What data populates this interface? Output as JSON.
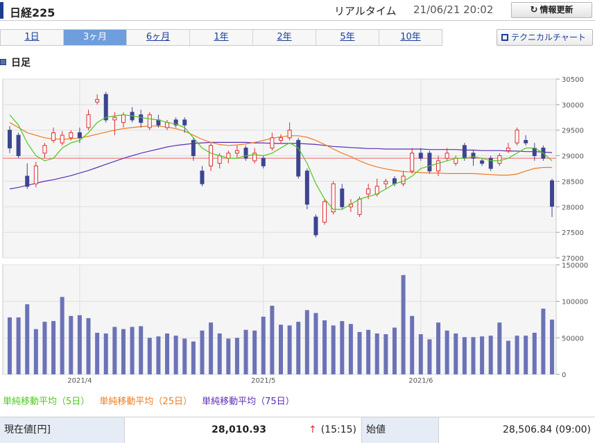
{
  "header": {
    "title": "日経225",
    "realtime_label": "リアルタイム",
    "timestamp": "21/06/21 20:02",
    "refresh_label": "情報更新",
    "refresh_icon": "refresh-icon"
  },
  "tabs": [
    {
      "label": "1日",
      "active": false
    },
    {
      "label": "3ヶ月",
      "active": true
    },
    {
      "label": "6ヶ月",
      "active": false
    },
    {
      "label": "1年",
      "active": false
    },
    {
      "label": "2年",
      "active": false
    },
    {
      "label": "5年",
      "active": false
    },
    {
      "label": "10年",
      "active": false
    }
  ],
  "technical_chart_label": "テクニカルチャート",
  "section_title": "日足",
  "legend": [
    {
      "label": "単純移動平均（5日）",
      "color": "#4cc81e"
    },
    {
      "label": "単純移動平均（25日）",
      "color": "#ef7a1e"
    },
    {
      "label": "単純移動平均（75日）",
      "color": "#5a2db4"
    }
  ],
  "quote": {
    "current_label": "現在値[円]",
    "current_value": "28,010.93",
    "time": "(15:15)",
    "open_label": "始値",
    "open_value": "28,506.84 (09:00)"
  },
  "chart_data": {
    "type": "candlestick",
    "price_axis": {
      "min": 27000,
      "max": 30500,
      "ticks": [
        30500,
        30000,
        29500,
        29000,
        28500,
        28000,
        27500,
        27000
      ]
    },
    "volume_axis": {
      "min": 0,
      "max": 150000,
      "ticks": [
        150000,
        100000,
        50000,
        0
      ]
    },
    "x_labels": [
      {
        "label": "2021/4",
        "index": 8
      },
      {
        "label": "2021/5",
        "index": 29
      },
      {
        "label": "2021/6",
        "index": 47
      }
    ],
    "reference_line": {
      "value": 28950,
      "color": "#f08080"
    },
    "colors": {
      "up": "#e0282e",
      "down": "#3d4591",
      "volume": "#6b72b6"
    },
    "candles": [
      [
        29500,
        29150,
        29580,
        29050
      ],
      [
        29400,
        29000,
        29450,
        28950
      ],
      [
        28600,
        28400,
        28850,
        28350
      ],
      [
        28450,
        28800,
        28880,
        28380
      ],
      [
        29050,
        29200,
        29250,
        28950
      ],
      [
        29300,
        29450,
        29550,
        29250
      ],
      [
        29250,
        29400,
        29480,
        29200
      ],
      [
        29350,
        29450,
        29500,
        29300
      ],
      [
        29450,
        29350,
        29550,
        29250
      ],
      [
        29550,
        29800,
        29900,
        29500
      ],
      [
        30050,
        30100,
        30200,
        30000
      ],
      [
        30200,
        29700,
        30250,
        29650
      ],
      [
        29700,
        29750,
        29850,
        29400
      ],
      [
        29650,
        29800,
        29850,
        29550
      ],
      [
        29850,
        29700,
        29950,
        29650
      ],
      [
        29800,
        29650,
        29900,
        29550
      ],
      [
        29550,
        29800,
        29850,
        29500
      ],
      [
        29700,
        29600,
        29800,
        29550
      ],
      [
        29550,
        29650,
        29700,
        29500
      ],
      [
        29700,
        29600,
        29750,
        29550
      ],
      [
        29700,
        29600,
        29750,
        29450
      ],
      [
        29300,
        29000,
        29350,
        28900
      ],
      [
        28700,
        28450,
        28800,
        28400
      ],
      [
        28800,
        29200,
        29250,
        28700
      ],
      [
        28850,
        29000,
        29050,
        28750
      ],
      [
        28950,
        29050,
        29100,
        28850
      ],
      [
        29050,
        29100,
        29200,
        28950
      ],
      [
        29150,
        28950,
        29200,
        28900
      ],
      [
        28900,
        29050,
        29150,
        28850
      ],
      [
        28950,
        28800,
        29000,
        28750
      ],
      [
        29150,
        29350,
        29450,
        29100
      ],
      [
        29300,
        29350,
        29420,
        29250
      ],
      [
        29350,
        29500,
        29650,
        29300
      ],
      [
        29300,
        28600,
        29350,
        28550
      ],
      [
        28700,
        28050,
        28750,
        27950
      ],
      [
        27800,
        27450,
        27850,
        27400
      ],
      [
        27700,
        28100,
        28150,
        27650
      ],
      [
        27900,
        28450,
        28500,
        27850
      ],
      [
        28350,
        28000,
        28450,
        27950
      ],
      [
        28000,
        28050,
        28150,
        27900
      ],
      [
        27850,
        28150,
        28200,
        27800
      ],
      [
        28250,
        28350,
        28450,
        28150
      ],
      [
        28250,
        28400,
        28550,
        28200
      ],
      [
        28450,
        28500,
        28550,
        28350
      ],
      [
        28550,
        28450,
        28600,
        28400
      ],
      [
        28450,
        28600,
        28700,
        28400
      ],
      [
        28700,
        29050,
        29150,
        28650
      ],
      [
        29050,
        28950,
        29150,
        28900
      ],
      [
        29050,
        28700,
        29100,
        28650
      ],
      [
        28700,
        28900,
        29000,
        28600
      ],
      [
        28950,
        29050,
        29150,
        28900
      ],
      [
        28850,
        28950,
        29000,
        28800
      ],
      [
        29200,
        28950,
        29250,
        28900
      ],
      [
        29050,
        28950,
        29100,
        28800
      ],
      [
        28900,
        28850,
        28950,
        28800
      ],
      [
        28950,
        28750,
        29000,
        28700
      ],
      [
        28850,
        29000,
        29050,
        28800
      ],
      [
        29100,
        29150,
        29250,
        29050
      ],
      [
        29250,
        29500,
        29550,
        29200
      ],
      [
        29300,
        29250,
        29400,
        29200
      ],
      [
        29150,
        29000,
        29250,
        28900
      ],
      [
        29150,
        28950,
        29200,
        28900
      ],
      [
        28510,
        28010,
        28550,
        27800
      ]
    ],
    "volumes": [
      78000,
      78000,
      96000,
      62000,
      72000,
      73000,
      106000,
      80000,
      81000,
      77000,
      57000,
      56000,
      65000,
      62000,
      65000,
      66000,
      50000,
      52000,
      56000,
      53000,
      49000,
      45000,
      60000,
      71000,
      56000,
      49000,
      50000,
      61000,
      60000,
      79000,
      94000,
      68000,
      67000,
      72000,
      88000,
      84000,
      74000,
      67000,
      73000,
      69000,
      58000,
      61000,
      56000,
      55000,
      64000,
      136000,
      80000,
      55000,
      48000,
      71000,
      60000,
      56000,
      51000,
      51000,
      52000,
      53000,
      71000,
      46000,
      53000,
      53000,
      57000,
      90000,
      75000
    ],
    "ma5": [
      29800,
      29600,
      29250,
      29000,
      28900,
      28950,
      29150,
      29250,
      29300,
      29450,
      29650,
      29750,
      29780,
      29800,
      29780,
      29750,
      29720,
      29700,
      29650,
      29620,
      29550,
      29350,
      29150,
      29050,
      29000,
      28950,
      28950,
      29000,
      29020,
      29000,
      29050,
      29150,
      29250,
      29150,
      28850,
      28450,
      28150,
      27950,
      27950,
      28050,
      28150,
      28200,
      28250,
      28350,
      28450,
      28500,
      28600,
      28750,
      28800,
      28850,
      28900,
      28950,
      28950,
      28980,
      28950,
      28900,
      28900,
      28950,
      29050,
      29150,
      29150,
      29050,
      28900
    ],
    "ma25": [
      29650,
      29550,
      29450,
      29400,
      29350,
      29330,
      29320,
      29330,
      29350,
      29380,
      29420,
      29460,
      29500,
      29530,
      29550,
      29570,
      29580,
      29580,
      29560,
      29530,
      29480,
      29400,
      29320,
      29260,
      29220,
      29200,
      29210,
      29230,
      29260,
      29300,
      29340,
      29370,
      29390,
      29390,
      29360,
      29300,
      29220,
      29130,
      29050,
      28980,
      28900,
      28830,
      28780,
      28740,
      28710,
      28690,
      28680,
      28670,
      28660,
      28660,
      28650,
      28650,
      28650,
      28650,
      28640,
      28630,
      28620,
      28620,
      28640,
      28700,
      28750,
      28770,
      28770
    ],
    "ma75": [
      28350,
      28380,
      28420,
      28460,
      28500,
      28530,
      28570,
      28610,
      28660,
      28710,
      28770,
      28830,
      28890,
      28950,
      29000,
      29050,
      29090,
      29130,
      29170,
      29200,
      29220,
      29240,
      29250,
      29260,
      29260,
      29260,
      29260,
      29260,
      29250,
      29250,
      29240,
      29240,
      29240,
      29240,
      29230,
      29220,
      29200,
      29180,
      29170,
      29160,
      29150,
      29140,
      29140,
      29130,
      29130,
      29130,
      29130,
      29130,
      29120,
      29120,
      29120,
      29120,
      29110,
      29110,
      29100,
      29100,
      29100,
      29090,
      29090,
      29080,
      29080,
      29070,
      29060
    ]
  }
}
